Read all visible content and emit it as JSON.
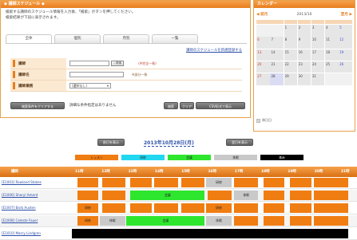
{
  "search": {
    "title": "◆ 講師スケジュール ◆",
    "instructions": [
      "検索する講師のスケジュール情報を入力後、「検索」ボタンを押してください。",
      "検索結果が下段に表示されます。"
    ],
    "tabs": [
      "全体",
      "個別",
      "月別",
      "一覧"
    ],
    "register_link": "講師のスケジュールを新規登録する",
    "fields": [
      {
        "label": "講師",
        "button": "検索",
        "hint": "(※完全一致)"
      },
      {
        "label": "講師名",
        "hint": "※部分一致"
      },
      {
        "label": "講師業務",
        "select": "(選択なし)"
      }
    ],
    "clear_button": "検索条件をクリアする",
    "no_condition": "詳細な条件指定はありません",
    "search_button": "検索",
    "clear_small": "クリア",
    "csv_button": "CSV形式で表示"
  },
  "calendar": {
    "title": "カレンダー",
    "prev": "◀ 前月",
    "month": "2013/10",
    "next": "翌月 ▶",
    "weekday_headers": [
      "",
      "",
      "",
      "",
      "",
      "",
      ""
    ],
    "weeks": [
      [
        "",
        "",
        "1",
        "2",
        "3",
        "4",
        "5"
      ],
      [
        "6",
        "7",
        "8",
        "9",
        "10",
        "11",
        "12"
      ],
      [
        "13",
        "14",
        "15",
        "16",
        "17",
        "18",
        "19"
      ],
      [
        "20",
        "21",
        "22",
        "23",
        "24",
        "25",
        "26"
      ],
      [
        "27",
        "28",
        "29",
        "30",
        "31",
        "",
        ""
      ]
    ],
    "legend": "休日日"
  },
  "schedule": {
    "prev_day": "前日を表示",
    "date": "2013年10月28日(月)",
    "next_day": "翌日を表示",
    "legend": [
      {
        "label": "レッスン",
        "color": "#f07d12"
      },
      {
        "label": "研修",
        "color": "#22d8f0"
      },
      {
        "label": "会議",
        "color": "#2ee62e"
      },
      {
        "label": "休暇",
        "color": "#c9c9c9"
      },
      {
        "label": "休み",
        "color": "#000000"
      }
    ],
    "header_label": "講師",
    "hours": [
      "11時",
      "12時",
      "13時",
      "14時",
      "15時",
      "16時",
      "17時",
      "18時",
      "19時",
      "20時",
      "21時"
    ],
    "teachers": [
      {
        "name": "[E1003] Rowland Stokes",
        "blocks": [
          {
            "s": 0.2,
            "e": 1.0,
            "t": "o",
            "label": ""
          },
          {
            "s": 1.15,
            "e": 2.0,
            "t": "o",
            "label": ""
          },
          {
            "s": 2.2,
            "e": 3.0,
            "t": "o",
            "label": ""
          },
          {
            "s": 3.1,
            "e": 4.0,
            "t": "o",
            "label": ""
          },
          {
            "s": 4.1,
            "e": 5.0,
            "t": "o",
            "label": ""
          },
          {
            "s": 5.05,
            "e": 6.0,
            "t": "gr",
            "label": "研修"
          },
          {
            "s": 6.1,
            "e": 7.0,
            "t": "o",
            "label": ""
          },
          {
            "s": 7.2,
            "e": 8.0,
            "t": "o",
            "label": ""
          },
          {
            "s": 8.2,
            "e": 9.0,
            "t": "o",
            "label": ""
          },
          {
            "s": 9.1,
            "e": 10.4,
            "t": "o",
            "label": ""
          }
        ]
      },
      {
        "name": "[E1006] Sheryl Ament",
        "blocks": [
          {
            "s": 0.2,
            "e": 1.0,
            "t": "o",
            "label": ""
          },
          {
            "s": 1.15,
            "e": 2.0,
            "t": "o",
            "label": ""
          },
          {
            "s": 2.2,
            "e": 5.0,
            "t": "g",
            "label": "会議"
          },
          {
            "s": 5.1,
            "e": 6.0,
            "t": "o",
            "label": ""
          },
          {
            "s": 6.1,
            "e": 7.0,
            "t": "gr",
            "label": "休暇"
          },
          {
            "s": 7.2,
            "e": 8.0,
            "t": "o",
            "label": ""
          },
          {
            "s": 8.2,
            "e": 9.0,
            "t": "o",
            "label": ""
          },
          {
            "s": 9.1,
            "e": 10.4,
            "t": "o",
            "label": ""
          }
        ]
      },
      {
        "name": "[E1007] Barb Austen",
        "blocks": [
          {
            "s": 0.2,
            "e": 1.0,
            "t": "o",
            "label": "研修"
          },
          {
            "s": 1.15,
            "e": 2.0,
            "t": "o",
            "label": ""
          },
          {
            "s": 2.2,
            "e": 3.0,
            "t": "o",
            "label": ""
          },
          {
            "s": 3.1,
            "e": 4.0,
            "t": "o",
            "label": ""
          },
          {
            "s": 4.1,
            "e": 5.0,
            "t": "o",
            "label": ""
          },
          {
            "s": 5.05,
            "e": 6.0,
            "t": "o",
            "label": "研修"
          },
          {
            "s": 6.1,
            "e": 7.0,
            "t": "o",
            "label": ""
          },
          {
            "s": 7.2,
            "e": 8.0,
            "t": "o",
            "label": ""
          },
          {
            "s": 8.2,
            "e": 9.0,
            "t": "o",
            "label": ""
          },
          {
            "s": 9.1,
            "e": 10.4,
            "t": "o",
            "label": ""
          }
        ]
      },
      {
        "name": "[E1008] Celeste Fauer",
        "blocks": [
          {
            "s": 0.2,
            "e": 1.0,
            "t": "o",
            "label": "研修"
          },
          {
            "s": 1.05,
            "e": 2.0,
            "t": "gr",
            "label": "休暇"
          },
          {
            "s": 2.05,
            "e": 5.0,
            "t": "g",
            "label": "会議"
          },
          {
            "s": 5.05,
            "e": 6.0,
            "t": "gr",
            "label": "休暇"
          },
          {
            "s": 6.1,
            "e": 7.0,
            "t": "o",
            "label": ""
          },
          {
            "s": 7.2,
            "e": 8.0,
            "t": "o",
            "label": ""
          },
          {
            "s": 8.2,
            "e": 9.0,
            "t": "o",
            "label": ""
          },
          {
            "s": 9.1,
            "e": 10.4,
            "t": "o",
            "label": ""
          }
        ]
      },
      {
        "name": "[E1010] Marcy Lindgren",
        "blocks": [
          {
            "s": 0.0,
            "e": 10.4,
            "t": "k",
            "label": ""
          }
        ]
      }
    ]
  }
}
